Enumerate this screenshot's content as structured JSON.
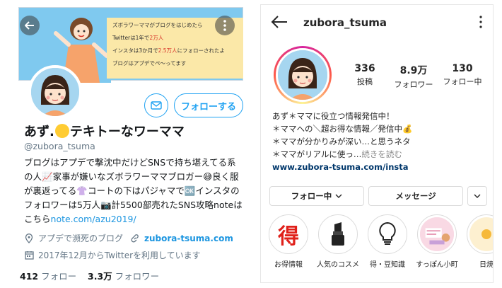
{
  "twitter": {
    "banner_lines": [
      "ズボラワーママがブログをはじめたら",
      "Twitterは1年で",
      "2万人",
      "インスタは3か月で",
      "2.5万人",
      "にフォローされたよ",
      "ブログはアプデでペ〜ってます"
    ],
    "follow_button": "フォローする",
    "display_name_a": "あず.",
    "display_name_b": "テキトーなワーママ",
    "handle": "@zubora_tsuma",
    "bio_text": "ブログはアプデで撃沈中だけどSNSで持ち堪えてる系の人📈家事が嫌いなズボラワーママブロガー😅良く服が裏返ってる👚コートの下はパジャマで🆗インスタのフォロワーは5万人📷計5500部売れたSNS攻略noteはこちら",
    "bio_link": "note.com/azu2019/",
    "location": "アプデで瀕死のブログ",
    "website": "zubora-tsuma.com",
    "joined": "2017年12月からTwitterを利用しています",
    "following_count": "412",
    "following_label": "フォロー",
    "followers_count": "3.3万",
    "followers_label": "フォロワー",
    "colors": {
      "accent": "#1da1f2",
      "muted": "#657786"
    }
  },
  "instagram": {
    "username": "zubora_tsuma",
    "stats": [
      {
        "value": "336",
        "label": "投稿"
      },
      {
        "value": "8.9万",
        "label": "フォロワー"
      },
      {
        "value": "130",
        "label": "フォロー中"
      }
    ],
    "bio_lines": [
      "あず＊ママに役立つ情報発信中！",
      "＊ママへの＼超お得な情報／発信中💰",
      "＊ママが分かりみが深い…と思うネタ",
      "＊ママがリアルに使っ…"
    ],
    "bio_more": "続きを読む",
    "bio_url": "www.zubora-tsuma.com/insta",
    "buttons": {
      "following": "フォロー中",
      "message": "メッセージ"
    },
    "highlights": [
      {
        "label": "お得情報",
        "icon": "otoku-kanji-icon",
        "glyph": "得"
      },
      {
        "label": "人気のコスメ",
        "icon": "lipstick-icon"
      },
      {
        "label": "得・豆知識",
        "icon": "lightbulb-icon"
      },
      {
        "label": "すっぽん小町",
        "icon": "product-icon"
      },
      {
        "label": "日焼",
        "icon": "sun-icon"
      }
    ]
  }
}
